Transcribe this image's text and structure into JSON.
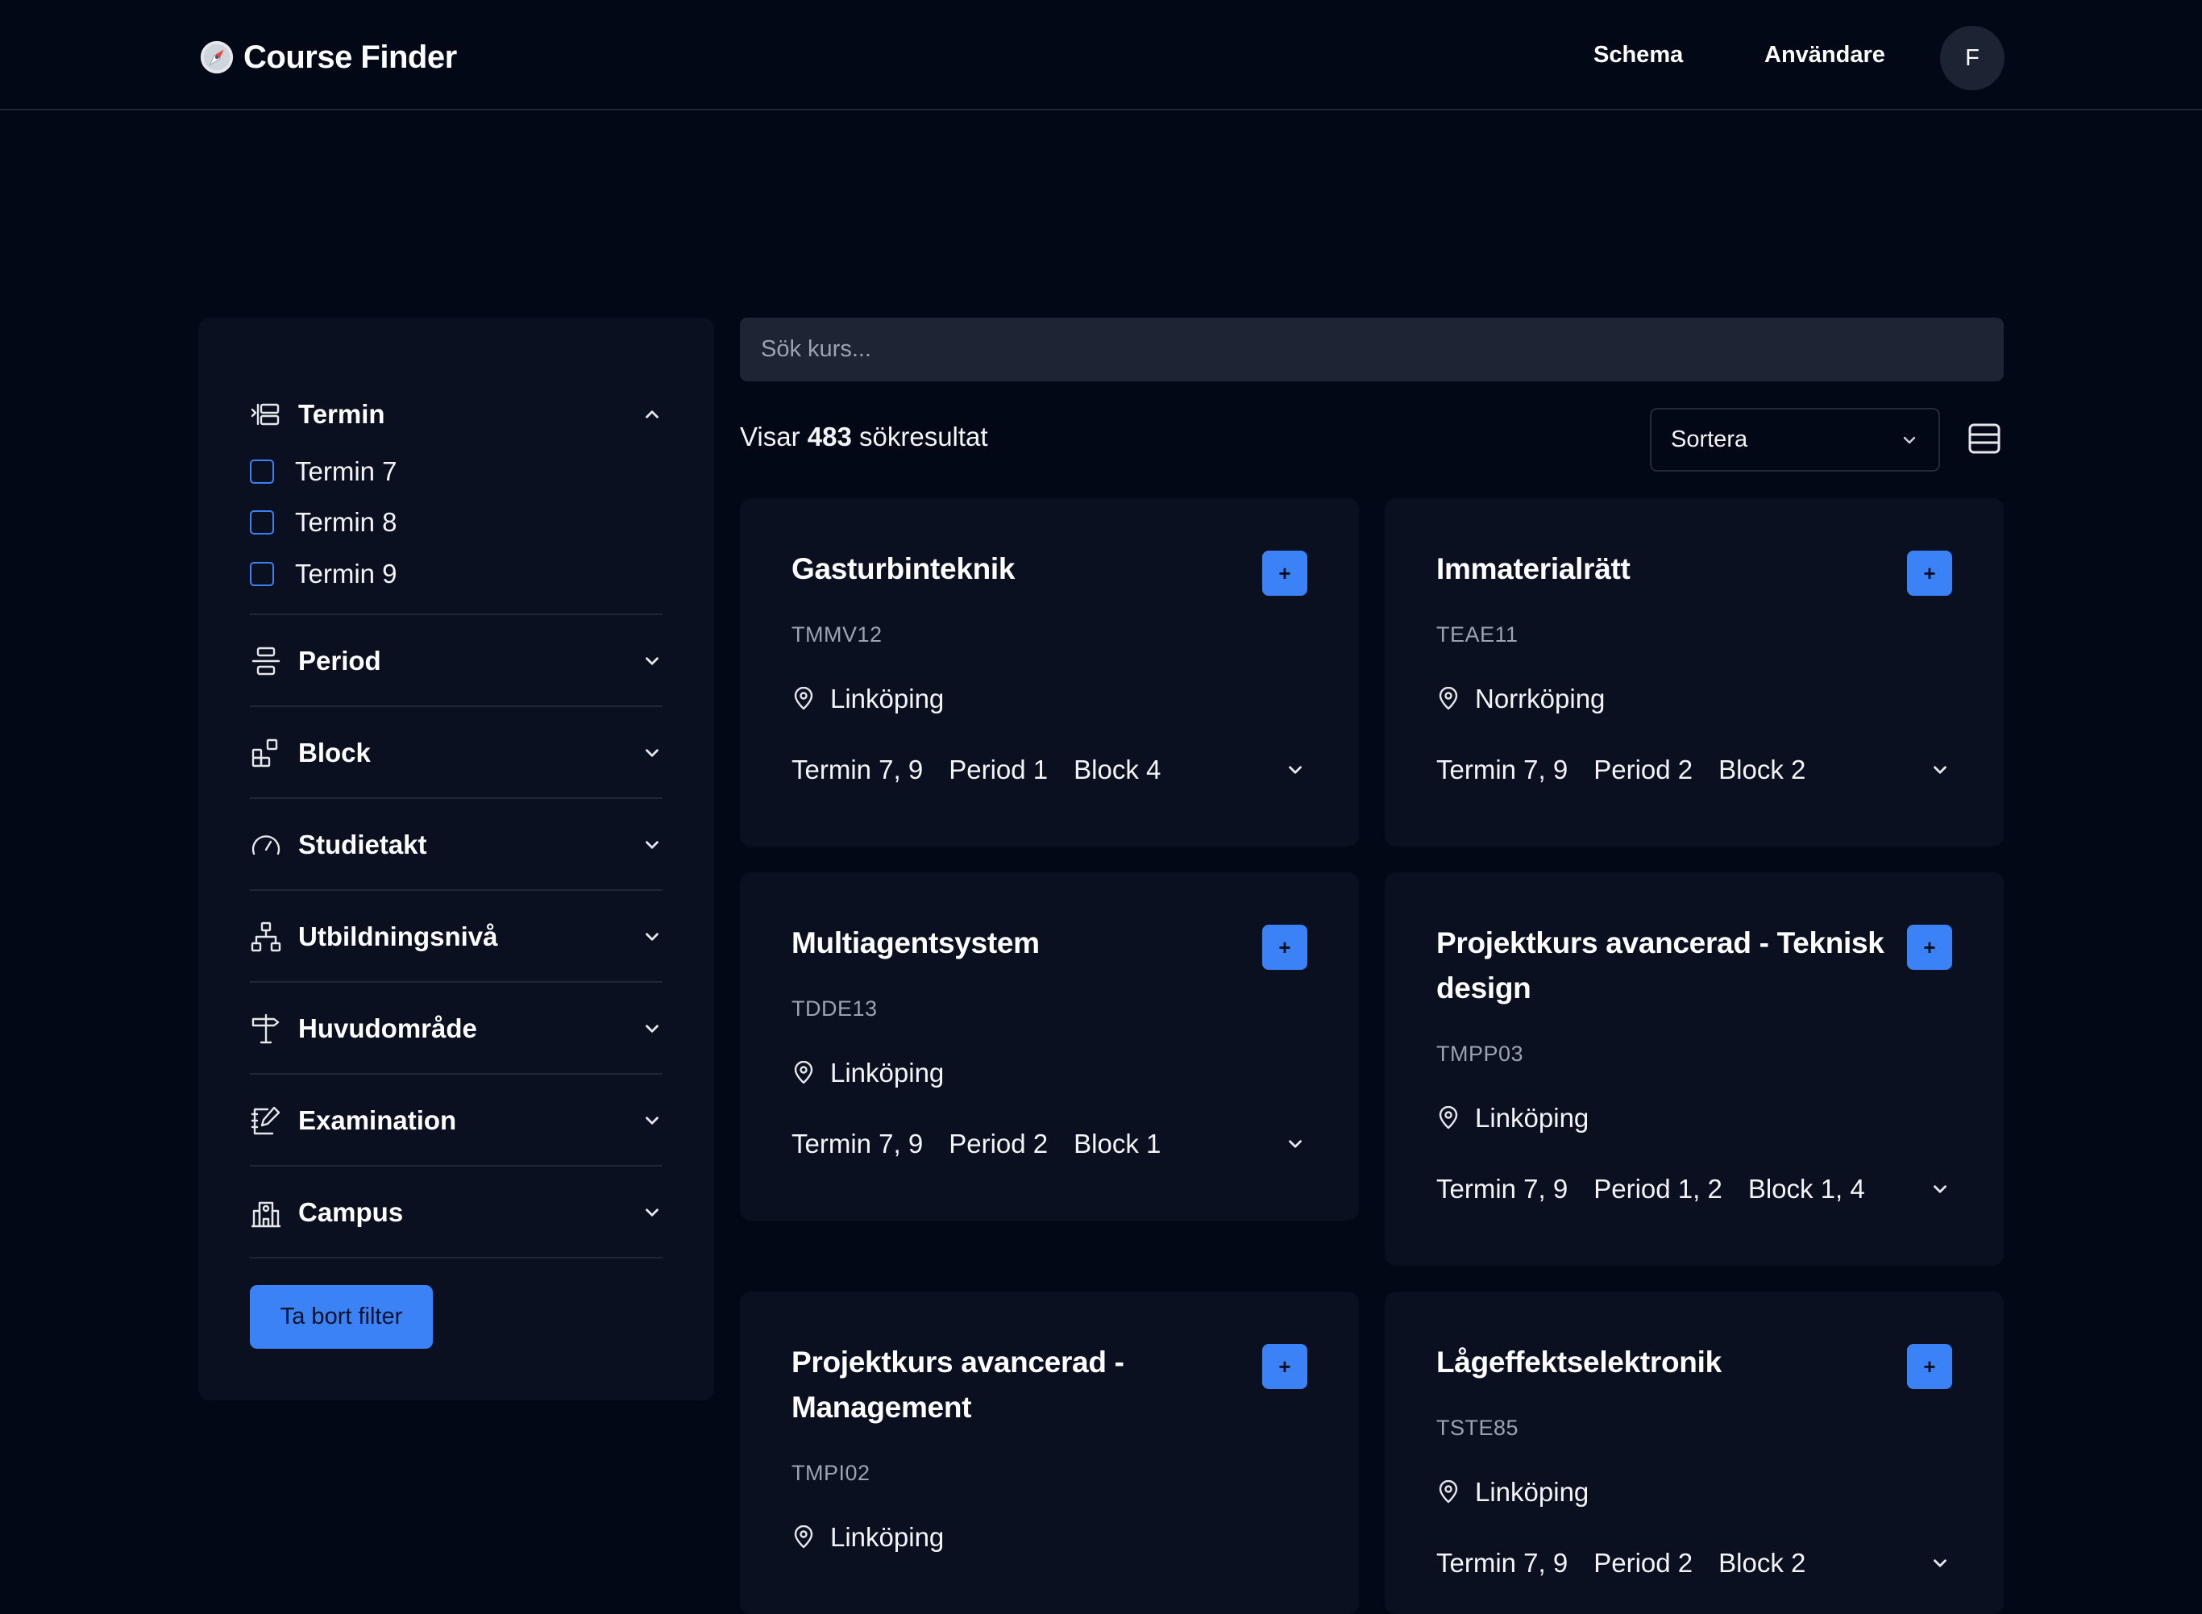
{
  "header": {
    "brand": "Course Finder",
    "nav": [
      {
        "label": "Schema"
      },
      {
        "label": "Användare"
      }
    ],
    "avatar_initial": "F"
  },
  "sidebar": {
    "sections": [
      {
        "label": "Termin",
        "icon": "term-icon",
        "expanded": true,
        "options": [
          "Termin 7",
          "Termin 8",
          "Termin 9"
        ]
      },
      {
        "label": "Period",
        "icon": "period-icon",
        "expanded": false
      },
      {
        "label": "Block",
        "icon": "block-icon",
        "expanded": false
      },
      {
        "label": "Studietakt",
        "icon": "gauge-icon",
        "expanded": false
      },
      {
        "label": "Utbildningsnivå",
        "icon": "hierarchy-icon",
        "expanded": false
      },
      {
        "label": "Huvudområde",
        "icon": "signpost-icon",
        "expanded": false
      },
      {
        "label": "Examination",
        "icon": "exam-icon",
        "expanded": false
      },
      {
        "label": "Campus",
        "icon": "building-icon",
        "expanded": false
      }
    ],
    "clear_button": "Ta bort filter"
  },
  "search": {
    "placeholder": "Sök kurs...",
    "value": ""
  },
  "results": {
    "prefix": "Visar",
    "count": "483",
    "suffix": "sökresultat"
  },
  "sort": {
    "label": "Sortera"
  },
  "colors": {
    "background": "#030816",
    "surface": "#0a1020",
    "accent": "#3b82f6",
    "muted_text": "#9aa3b2"
  },
  "courses": [
    {
      "title": "Gasturbinteknik",
      "code": "TMMV12",
      "location": "Linköping",
      "term": "Termin 7, 9",
      "period": "Period 1",
      "block": "Block 4"
    },
    {
      "title": "Immaterialrätt",
      "code": "TEAE11",
      "location": "Norrköping",
      "term": "Termin 7, 9",
      "period": "Period 2",
      "block": "Block 2"
    },
    {
      "title": "Multiagentsystem",
      "code": "TDDE13",
      "location": "Linköping",
      "term": "Termin 7, 9",
      "period": "Period 2",
      "block": "Block 1"
    },
    {
      "title": "Projektkurs avancerad - Teknisk design",
      "code": "TMPP03",
      "location": "Linköping",
      "term": "Termin 7, 9",
      "period": "Period 1, 2",
      "block": "Block 1, 4"
    },
    {
      "title": "Projektkurs avancerad - Management",
      "code": "TMPI02",
      "location": "Linköping",
      "term": "",
      "period": "",
      "block": ""
    },
    {
      "title": "Lågeffektselektronik",
      "code": "TSTE85",
      "location": "Linköping",
      "term": "Termin 7, 9",
      "period": "Period 2",
      "block": "Block 2"
    }
  ],
  "add_symbol": "+"
}
